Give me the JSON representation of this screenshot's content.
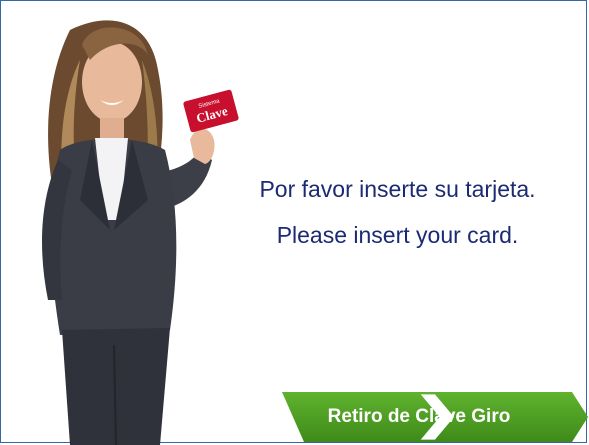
{
  "message": {
    "es": "Por favor inserte su tarjeta.",
    "en": "Please insert your card."
  },
  "card": {
    "brand_small": "Sistema",
    "brand": "Clave"
  },
  "action_button": {
    "label": "Retiro de Clave Giro",
    "color": "#4c9a22",
    "arrow_icon": "chevron-right-icon"
  },
  "colors": {
    "text": "#1c2a73",
    "frame": "#2f6aa6",
    "card_red": "#c8102e"
  }
}
